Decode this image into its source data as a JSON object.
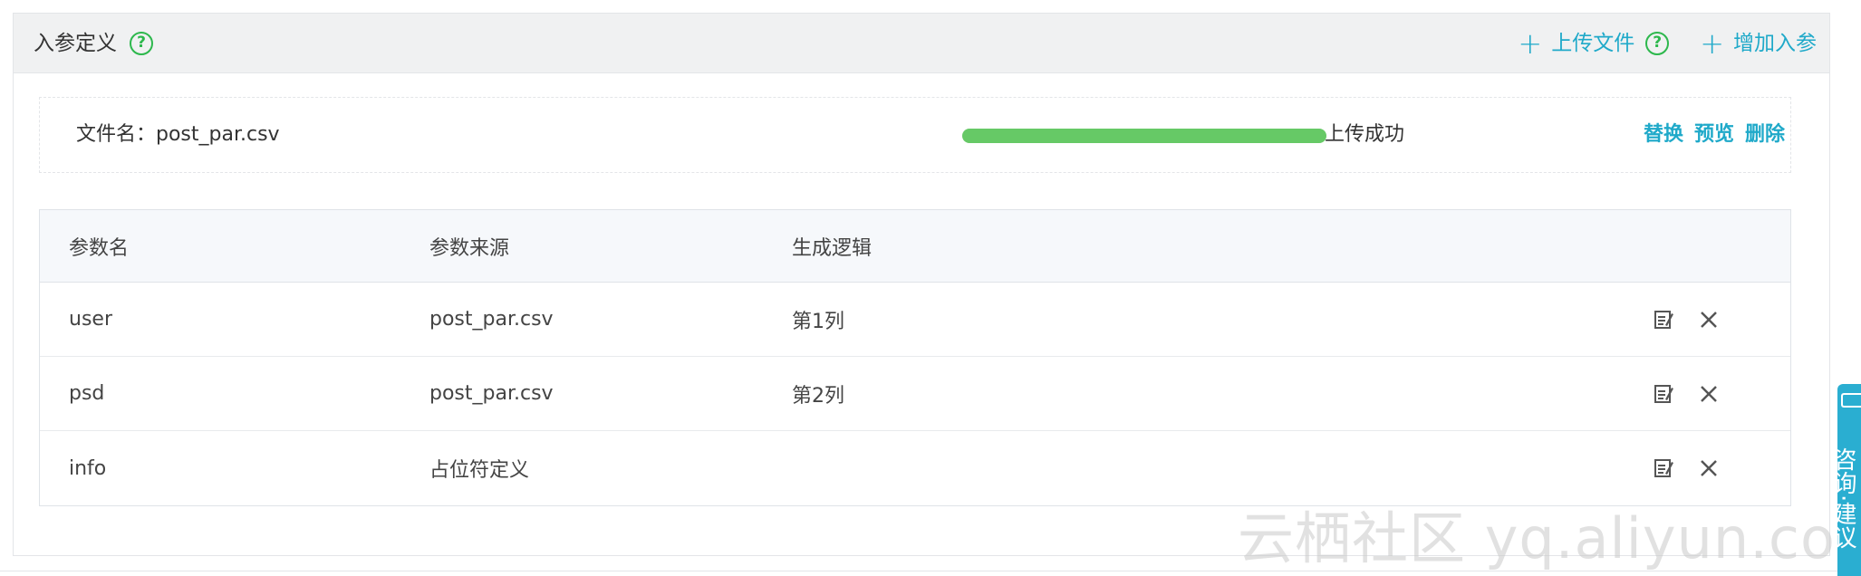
{
  "panel": {
    "title": "入参定义",
    "help_glyph": "?",
    "upload_file_label": "上传文件",
    "add_param_label": "增加入参"
  },
  "file": {
    "label": "文件名：post_par.csv",
    "upload_progress": 1.0,
    "status": "上传成功",
    "replace_label": "替换",
    "preview_label": "预览",
    "delete_label": "删除"
  },
  "table": {
    "headers": [
      "参数名",
      "参数来源",
      "生成逻辑"
    ],
    "rows": [
      {
        "name": "user",
        "source": "post_par.csv",
        "logic": "第1列"
      },
      {
        "name": "psd",
        "source": "post_par.csv",
        "logic": "第2列"
      },
      {
        "name": "info",
        "source": "占位符定义",
        "logic": ""
      }
    ]
  },
  "side_tab": {
    "text": "咨询·建议"
  },
  "watermark": "云栖社区 yq.aliyun.com",
  "colors": {
    "accent": "#1fa9c9",
    "help_green": "#2db84d",
    "progress": "#66c966",
    "side_tab": "#2aaed1"
  },
  "icons": {
    "help": "help-circle-icon",
    "plus": "plus-icon",
    "edit": "edit-icon",
    "close": "close-icon"
  }
}
